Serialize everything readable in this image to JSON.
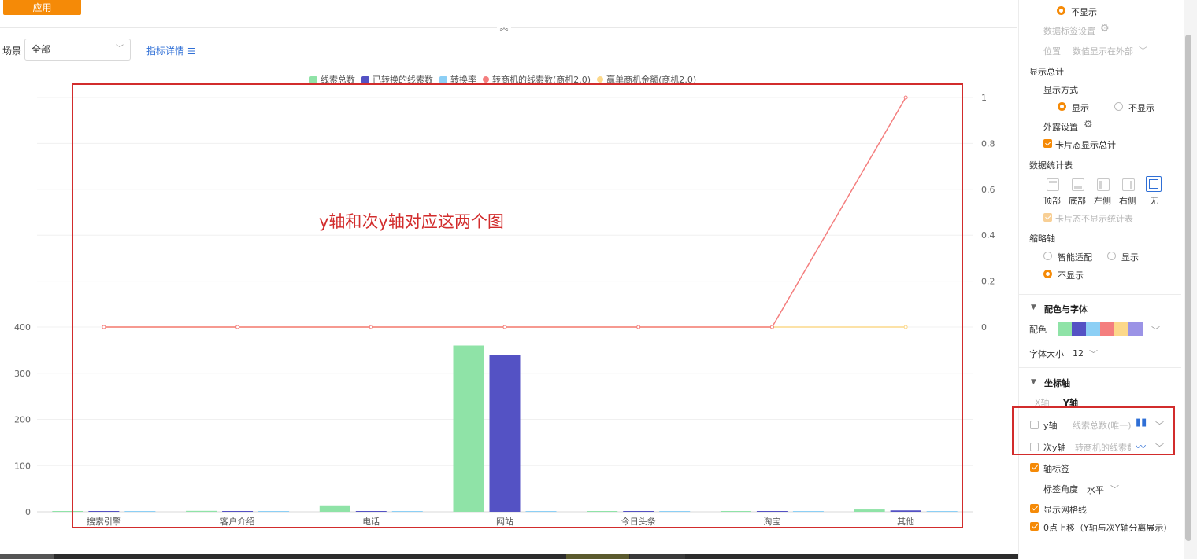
{
  "toolbar": {
    "apply_label": "应用"
  },
  "filter": {
    "scene_label": "场景",
    "scene_value": "全部",
    "metric_details_label": "指标详情"
  },
  "annotation": {
    "text": "y轴和次y轴对应这两个图"
  },
  "chart_data": {
    "type": "bar",
    "categories": [
      "搜索引擎",
      "客户介绍",
      "电话",
      "网站",
      "今日头条",
      "淘宝",
      "其他"
    ],
    "series": [
      {
        "name": "线索总数",
        "kind": "bar",
        "axis": "y",
        "color": "#8fe3a7",
        "values": [
          1,
          2,
          14,
          360,
          1,
          1,
          5
        ]
      },
      {
        "name": "已转换的线索数",
        "kind": "bar",
        "axis": "y",
        "color": "#5452c4",
        "values": [
          1,
          0,
          1,
          340,
          0,
          0,
          3
        ]
      },
      {
        "name": "转换率",
        "kind": "bar",
        "axis": "y",
        "color": "#8ccff5",
        "values": [
          0,
          0,
          0,
          0,
          0,
          0,
          0
        ]
      },
      {
        "name": "转商机的线索数(商机2.0)",
        "kind": "line",
        "axis": "y2",
        "color": "#f47e7e",
        "values": [
          0,
          0,
          0,
          0,
          0,
          0,
          1
        ]
      },
      {
        "name": "赢单商机金额(商机2.0)",
        "kind": "line",
        "axis": "y2",
        "color": "#fcd88a",
        "values": [
          0,
          0,
          0,
          0,
          0,
          0,
          0
        ]
      }
    ],
    "y_ticks": [
      "0",
      "100",
      "200",
      "300",
      "400"
    ],
    "y2_ticks": [
      "0",
      "0.2",
      "0.4",
      "0.6",
      "0.8",
      "1"
    ],
    "ylim": [
      0,
      400
    ],
    "y2lim": [
      0,
      1
    ],
    "grid": true,
    "legend": "top-center"
  },
  "panel": {
    "label_display_none": "不显示",
    "data_label_settings": "数据标签设置",
    "position_label": "位置",
    "position_value": "数值显示在外部",
    "show_total": "显示总计",
    "display_mode": "显示方式",
    "display_show": "显示",
    "display_hide": "不显示",
    "outer_settings": "外露设置",
    "card_show_total": "卡片态显示总计",
    "stats_table": "数据统计表",
    "stats_positions": [
      "顶部",
      "底部",
      "左侧",
      "右侧",
      "无"
    ],
    "card_hide_stats": "卡片态不显示统计表",
    "thumbnail_axis": "缩略轴",
    "thumb_smart": "智能适配",
    "thumb_show": "显示",
    "thumb_hide": "不显示",
    "color_font_section": "配色与字体",
    "color_label": "配色",
    "palette": [
      "#8fe3a7",
      "#5452c4",
      "#8ccff5",
      "#f47e7e",
      "#fcd88a",
      "#9b93e6"
    ],
    "font_size_label": "字体大小",
    "font_size_value": "12",
    "axis_section": "坐标轴",
    "tab_x": "X轴",
    "tab_y": "Y轴",
    "y_axis_label": "y轴",
    "y_axis_value": "线索总数(唯一)",
    "y2_axis_label": "次y轴",
    "y2_axis_value": "转商机的线索数",
    "axis_tick_label": "轴标签",
    "label_angle": "标签角度",
    "label_angle_value": "水平",
    "show_gridlines": "显示网格线",
    "zero_up": "0点上移（Y轴与次Y轴分离展示）"
  }
}
